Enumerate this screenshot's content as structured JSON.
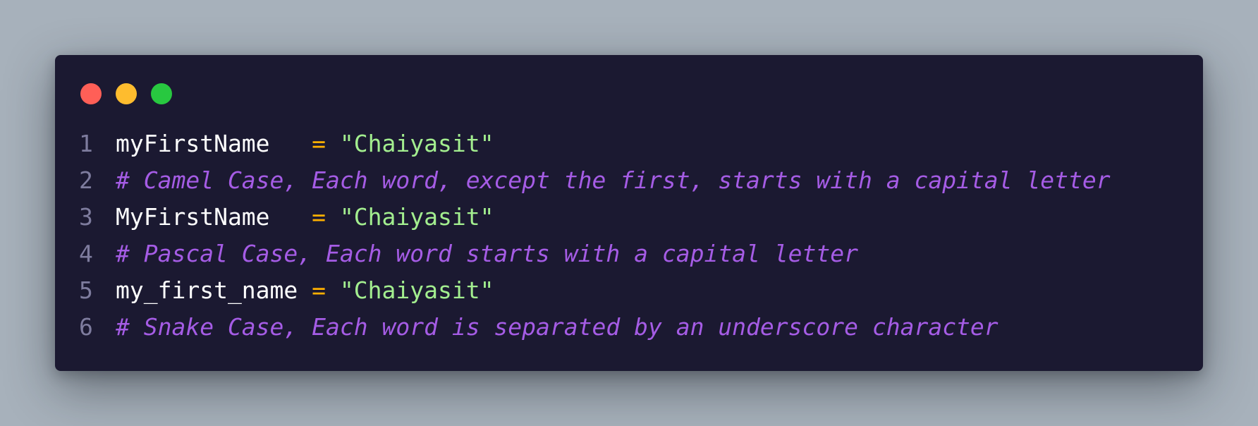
{
  "window": {
    "controls": [
      "close",
      "minimize",
      "maximize"
    ]
  },
  "code": {
    "lines": [
      {
        "num": "1",
        "ident": "myFirstName  ",
        "op": " = ",
        "str": "\"Chaiyasit\""
      },
      {
        "num": "2",
        "comment": "# Camel Case, Each word, except the first, starts with a capital letter"
      },
      {
        "num": "3",
        "ident": "MyFirstName  ",
        "op": " = ",
        "str": "\"Chaiyasit\""
      },
      {
        "num": "4",
        "comment": "# Pascal Case, Each word starts with a capital letter"
      },
      {
        "num": "5",
        "ident": "my_first_name",
        "op": " = ",
        "str": "\"Chaiyasit\""
      },
      {
        "num": "6",
        "comment": "# Snake Case, Each word is separated by an underscore character"
      }
    ]
  },
  "colors": {
    "background": "#a7b1bb",
    "window": "#1b1931",
    "identifier": "#ffffff",
    "operator": "#ffb000",
    "string": "#a3ee8f",
    "comment": "#a55ce5",
    "line_number": "#7e7c9e",
    "close": "#ff5f57",
    "minimize": "#febc2e",
    "maximize": "#28c840"
  }
}
